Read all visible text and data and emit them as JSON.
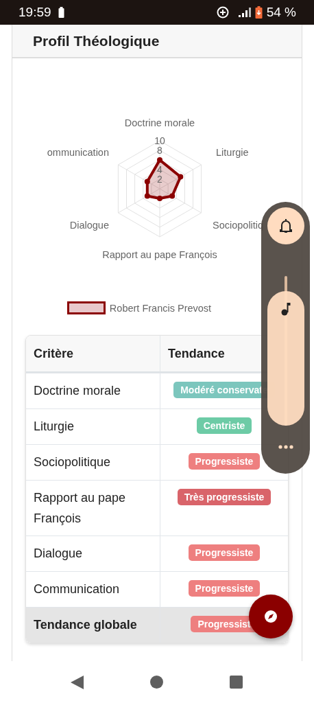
{
  "status_bar": {
    "time": "19:59",
    "battery": "54 %"
  },
  "card": {
    "title": "Profil Théologique",
    "chart_data": {
      "type": "radar",
      "categories": [
        "Doctrine morale",
        "Liturgie",
        "Sociopolitiq",
        "Rapport au pape François",
        "Dialogue",
        "ommunication"
      ],
      "series": [
        {
          "name": "Robert Francis Prevost",
          "color": "#8b0000",
          "values": [
            6,
            5,
            3,
            2,
            3,
            3
          ]
        }
      ],
      "ylim": [
        0,
        10
      ],
      "yticks": [
        2,
        4,
        8,
        10
      ]
    }
  },
  "table": {
    "columns": [
      "Critère",
      "Tendance"
    ],
    "rows": [
      {
        "criterion": "Doctrine morale",
        "tendency": "Modéré conservate",
        "color": "#7cc6bd"
      },
      {
        "criterion": "Liturgie",
        "tendency": "Centriste",
        "color": "#6dcba6"
      },
      {
        "criterion": "Sociopolitique",
        "tendency": "Progressiste",
        "color": "#ee7f7f"
      },
      {
        "criterion": "Rapport au pape François",
        "tendency": "Très progressiste",
        "color": "#d9646a"
      },
      {
        "criterion": "Dialogue",
        "tendency": "Progressiste",
        "color": "#ee7f7f"
      },
      {
        "criterion": "Communication",
        "tendency": "Progressiste",
        "color": "#ee7f7f"
      },
      {
        "criterion": "Tendance globale",
        "tendency": "Progressist",
        "color": "#ee7f7f",
        "kind": "total"
      }
    ]
  },
  "volume_panel": {
    "level": 0.9
  }
}
